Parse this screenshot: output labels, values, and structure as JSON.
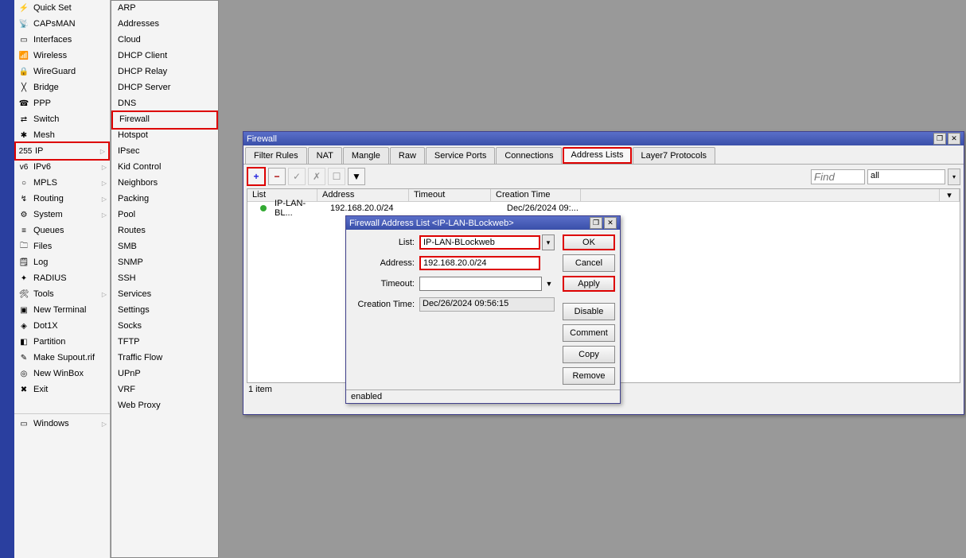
{
  "menu": [
    {
      "label": "Quick Set",
      "icon": "⚡"
    },
    {
      "label": "CAPsMAN",
      "icon": "📡"
    },
    {
      "label": "Interfaces",
      "icon": "▭"
    },
    {
      "label": "Wireless",
      "icon": "📶"
    },
    {
      "label": "WireGuard",
      "icon": "🔒"
    },
    {
      "label": "Bridge",
      "icon": "╳"
    },
    {
      "label": "PPP",
      "icon": "☎"
    },
    {
      "label": "Switch",
      "icon": "⇄"
    },
    {
      "label": "Mesh",
      "icon": "✱"
    },
    {
      "label": "IP",
      "icon": "255",
      "arrow": true,
      "red": true
    },
    {
      "label": "IPv6",
      "icon": "v6",
      "arrow": true
    },
    {
      "label": "MPLS",
      "icon": "○",
      "arrow": true
    },
    {
      "label": "Routing",
      "icon": "↯",
      "arrow": true
    },
    {
      "label": "System",
      "icon": "⚙",
      "arrow": true
    },
    {
      "label": "Queues",
      "icon": "≡"
    },
    {
      "label": "Files",
      "icon": "🗀"
    },
    {
      "label": "Log",
      "icon": "🗒"
    },
    {
      "label": "RADIUS",
      "icon": "✦"
    },
    {
      "label": "Tools",
      "icon": "🛠",
      "arrow": true
    },
    {
      "label": "New Terminal",
      "icon": "▣"
    },
    {
      "label": "Dot1X",
      "icon": "◈"
    },
    {
      "label": "Partition",
      "icon": "◧"
    },
    {
      "label": "Make Supout.rif",
      "icon": "✎"
    },
    {
      "label": "New WinBox",
      "icon": "◎"
    },
    {
      "label": "Exit",
      "icon": "✖"
    }
  ],
  "menu_windows": {
    "label": "Windows",
    "icon": "▭",
    "arrow": true
  },
  "submenu": [
    "ARP",
    "Addresses",
    "Cloud",
    "DHCP Client",
    "DHCP Relay",
    "DHCP Server",
    "DNS",
    "Firewall",
    "Hotspot",
    "IPsec",
    "Kid Control",
    "Neighbors",
    "Packing",
    "Pool",
    "Routes",
    "SMB",
    "SNMP",
    "SSH",
    "Services",
    "Settings",
    "Socks",
    "TFTP",
    "Traffic Flow",
    "UPnP",
    "VRF",
    "Web Proxy"
  ],
  "submenu_red": "Firewall",
  "firewall": {
    "title": "Firewall",
    "tabs": [
      "Filter Rules",
      "NAT",
      "Mangle",
      "Raw",
      "Service Ports",
      "Connections",
      "Address Lists",
      "Layer7 Protocols"
    ],
    "active_tab": "Address Lists",
    "find_placeholder": "Find",
    "filter_value": "all",
    "columns": {
      "list": "List",
      "address": "Address",
      "timeout": "Timeout",
      "creation": "Creation Time"
    },
    "rows": [
      {
        "list": "IP-LAN-BL...",
        "address": "192.168.20.0/24",
        "timeout": "",
        "creation": "Dec/26/2024 09:..."
      }
    ],
    "status": "1 item"
  },
  "dialog": {
    "title": "Firewall Address List <IP-LAN-BLockweb>",
    "labels": {
      "list": "List:",
      "address": "Address:",
      "timeout": "Timeout:",
      "creation": "Creation Time:"
    },
    "values": {
      "list": "IP-LAN-BLockweb",
      "address": "192.168.20.0/24",
      "timeout": "",
      "creation": "Dec/26/2024 09:56:15"
    },
    "buttons": {
      "ok": "OK",
      "cancel": "Cancel",
      "apply": "Apply",
      "disable": "Disable",
      "comment": "Comment",
      "copy": "Copy",
      "remove": "Remove"
    },
    "status": "enabled"
  }
}
